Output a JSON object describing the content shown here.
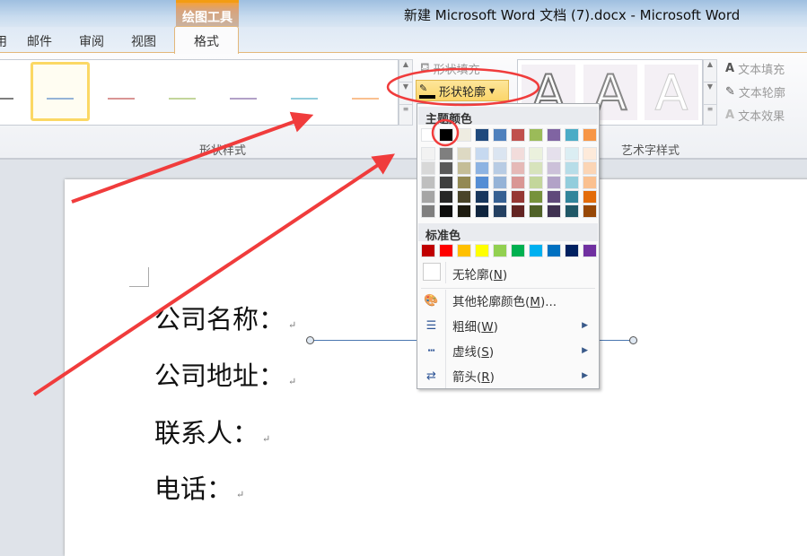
{
  "window": {
    "title": "新建 Microsoft Word 文档 (7).docx - Microsoft Word",
    "context_tab": "绘图工具"
  },
  "tabs": [
    {
      "label": "邮件"
    },
    {
      "label": "审阅"
    },
    {
      "label": "视图"
    },
    {
      "label": "格式"
    }
  ],
  "ribbon": {
    "shape_styles_label": "形状样式",
    "shape_fill": "形状填充",
    "shape_outline": "形状轮廓",
    "wordart_label": "艺术字样式",
    "wordart_glyph": "A",
    "text_fill": "文本填充",
    "text_outline": "文本轮廓",
    "text_effects": "文本效果",
    "line_colors": [
      "#7f7f7f",
      "#95b3d7",
      "#d99594",
      "#c3d69b",
      "#b2a1c7",
      "#92cddc",
      "#fac090"
    ]
  },
  "menu": {
    "theme_header": "主题颜色",
    "theme_top": [
      "#ffffff",
      "#000000",
      "#eeece1",
      "#1f497d",
      "#4f81bd",
      "#c0504d",
      "#9bbb59",
      "#8064a2",
      "#4bacc6",
      "#f79646"
    ],
    "theme_shades": [
      [
        "#f2f2f2",
        "#7f7f7f",
        "#ddd9c3",
        "#c6d9f0",
        "#dbe5f1",
        "#f2dcdb",
        "#ebf1dd",
        "#e5e0ec",
        "#dbeef3",
        "#fdeada"
      ],
      [
        "#d8d8d8",
        "#595959",
        "#c4bd97",
        "#8db3e2",
        "#b8cce4",
        "#e5b9b7",
        "#d7e3bc",
        "#ccc1d9",
        "#b7dde8",
        "#fbd5b5"
      ],
      [
        "#bfbfbf",
        "#3f3f3f",
        "#938953",
        "#548dd4",
        "#95b3d7",
        "#d99694",
        "#c3d69b",
        "#b2a2c7",
        "#92cddc",
        "#fac08f"
      ],
      [
        "#a5a5a5",
        "#262626",
        "#494429",
        "#17365d",
        "#366092",
        "#953734",
        "#76923c",
        "#5f497a",
        "#31859b",
        "#e36c09"
      ],
      [
        "#7f7f7f",
        "#0c0c0c",
        "#1d1b10",
        "#0f243e",
        "#244061",
        "#632423",
        "#4f6128",
        "#3f3151",
        "#205867",
        "#974806"
      ]
    ],
    "standard_header": "标准色",
    "standard": [
      "#c00000",
      "#ff0000",
      "#ffc000",
      "#ffff00",
      "#92d050",
      "#00b050",
      "#00b0f0",
      "#0070c0",
      "#002060",
      "#7030a0"
    ],
    "no_outline": {
      "text": "无轮廓(",
      "key": "N",
      "end": ")"
    },
    "more_colors": {
      "text": "其他轮廓颜色(",
      "key": "M",
      "end": ")..."
    },
    "weight": {
      "text": "粗细(",
      "key": "W",
      "end": ")"
    },
    "dashes": {
      "text": "虚线(",
      "key": "S",
      "end": ")"
    },
    "arrows": {
      "text": "箭头(",
      "key": "R",
      "end": ")"
    }
  },
  "document": {
    "lines": [
      "公司名称：",
      "公司地址：",
      "联系人：",
      "电话："
    ],
    "para_mark": "↵"
  },
  "annotation_color": "#f03c3c"
}
